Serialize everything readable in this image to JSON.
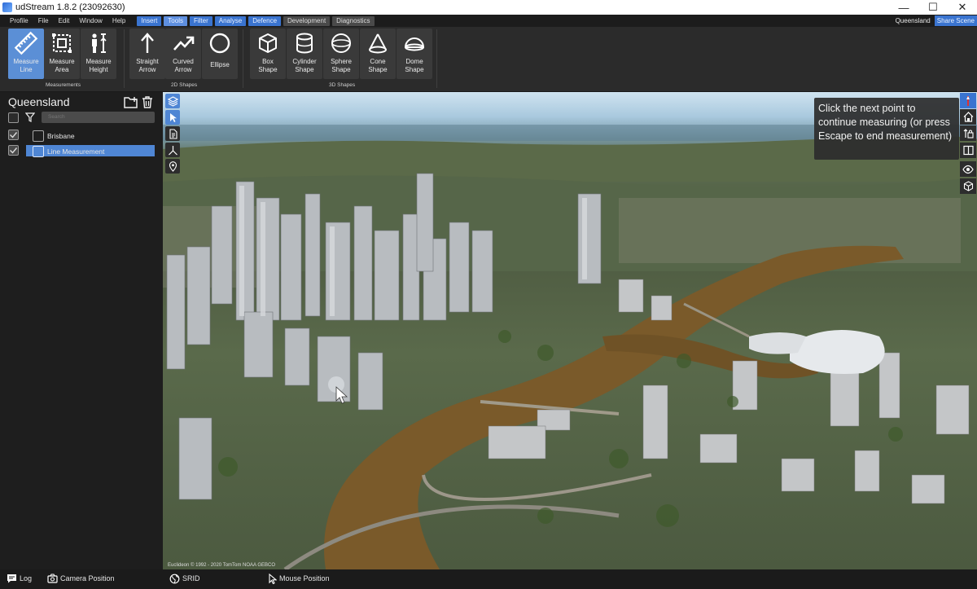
{
  "window": {
    "title": "udStream 1.8.2 (23092630)",
    "controls": {
      "minimize": "—",
      "maximize": "☐",
      "close": "✕"
    }
  },
  "menubar": {
    "items": [
      "Profile",
      "File",
      "Edit",
      "Window",
      "Help"
    ],
    "tabs": [
      "Insert",
      "Tools",
      "Filter",
      "Analyse",
      "Defence",
      "Development",
      "Diagnostics"
    ],
    "active_tab": "Tools",
    "project_name": "Queensland",
    "share_label": "Share Scene"
  },
  "ribbon": {
    "groups": [
      {
        "label": "Measurements",
        "buttons": [
          "Measure\nLine",
          "Measure\nArea",
          "Measure\nHeight"
        ],
        "active": "Measure\nLine"
      },
      {
        "label": "2D Shapes",
        "buttons": [
          "Straight\nArrow",
          "Curved\nArrow",
          "Ellipse"
        ]
      },
      {
        "label": "3D Shapes",
        "buttons": [
          "Box\nShape",
          "Cylinder\nShape",
          "Sphere\nShape",
          "Cone\nShape",
          "Dome\nShape"
        ]
      }
    ]
  },
  "scene_panel": {
    "title": "Queensland",
    "search_placeholder": "Search",
    "items": [
      {
        "label": "Brisbane",
        "checked": true,
        "selected": false
      },
      {
        "label": "Line Measurement",
        "checked": true,
        "selected": true
      }
    ]
  },
  "viewport": {
    "tooltip": "Click  the next point to continue measuring (or press Escape to end measurement)",
    "attribution": "Euclideon © 1992 - 2020 TomTom NOAA GEBCO",
    "left_tools": [
      "layers-icon",
      "select-icon",
      "document-icon",
      "axes-icon",
      "location-pin-icon"
    ],
    "right_tools": [
      "compass-icon",
      "home-icon",
      "lock-height-icon",
      "split-view-icon",
      "eye-icon",
      "cube-icon"
    ]
  },
  "statusbar": {
    "log": "Log",
    "camera_position": "Camera Position",
    "srid": "SRID",
    "mouse_position": "Mouse Position"
  },
  "colors": {
    "accent": "#3a74d0",
    "active_button": "#5b8fd6",
    "panel_bg": "#1e1e1e",
    "river": "#7a5a2a"
  }
}
